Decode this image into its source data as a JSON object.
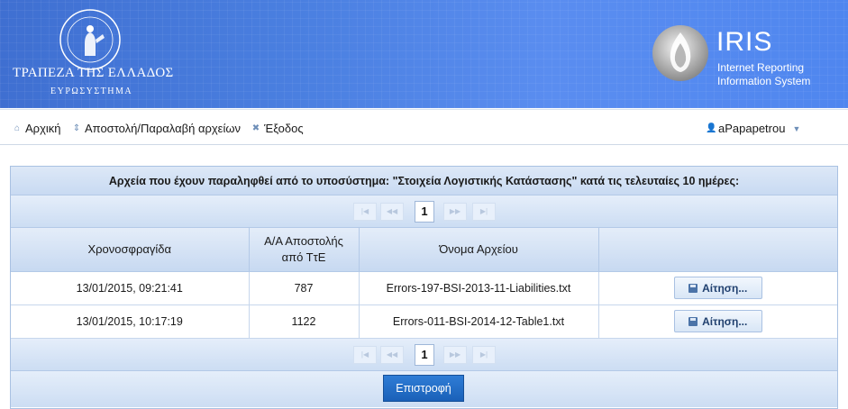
{
  "header": {
    "bank_name": "ΤΡΑΠΕΖΑ ΤΗΣ ΕΛΛΑΔΟΣ",
    "bank_sub": "ΕΥΡΩΣΥΣΤΗΜΑ",
    "logo_text": "IRIS",
    "logo_sub1": "Internet Reporting",
    "logo_sub2": "Information System"
  },
  "menu": {
    "home": "Αρχική",
    "send_receive": "Αποστολή/Παραλαβή αρχείων",
    "logout": "Έξοδος",
    "user": "aPapapetrou"
  },
  "panel": {
    "caption": "Αρχεία που έχουν παραληφθεί από το υποσύστημα: \"Στοιχεία Λογιστικής Κατάστασης\" κατά τις τελευταίες 10 ημέρες:",
    "page": "1",
    "columns": [
      "Χρονοσφραγίδα",
      "Α/Α Αποστολής από ΤτΕ",
      "Όνομα Αρχείου",
      ""
    ],
    "rows": [
      {
        "timestamp": "13/01/2015, 09:21:41",
        "seq": "787",
        "filename": "Errors-197-BSI-2013-11-Liabilities.txt",
        "action": "Αίτηση..."
      },
      {
        "timestamp": "13/01/2015, 10:17:19",
        "seq": "1122",
        "filename": "Errors-011-BSI-2014-12-Table1.txt",
        "action": "Αίτηση..."
      }
    ],
    "back_label": "Επιστροφή"
  },
  "colors": {
    "banner": "#4a7fe0",
    "panel_border": "#a9c1e2",
    "back_button": "#1a60b8"
  }
}
